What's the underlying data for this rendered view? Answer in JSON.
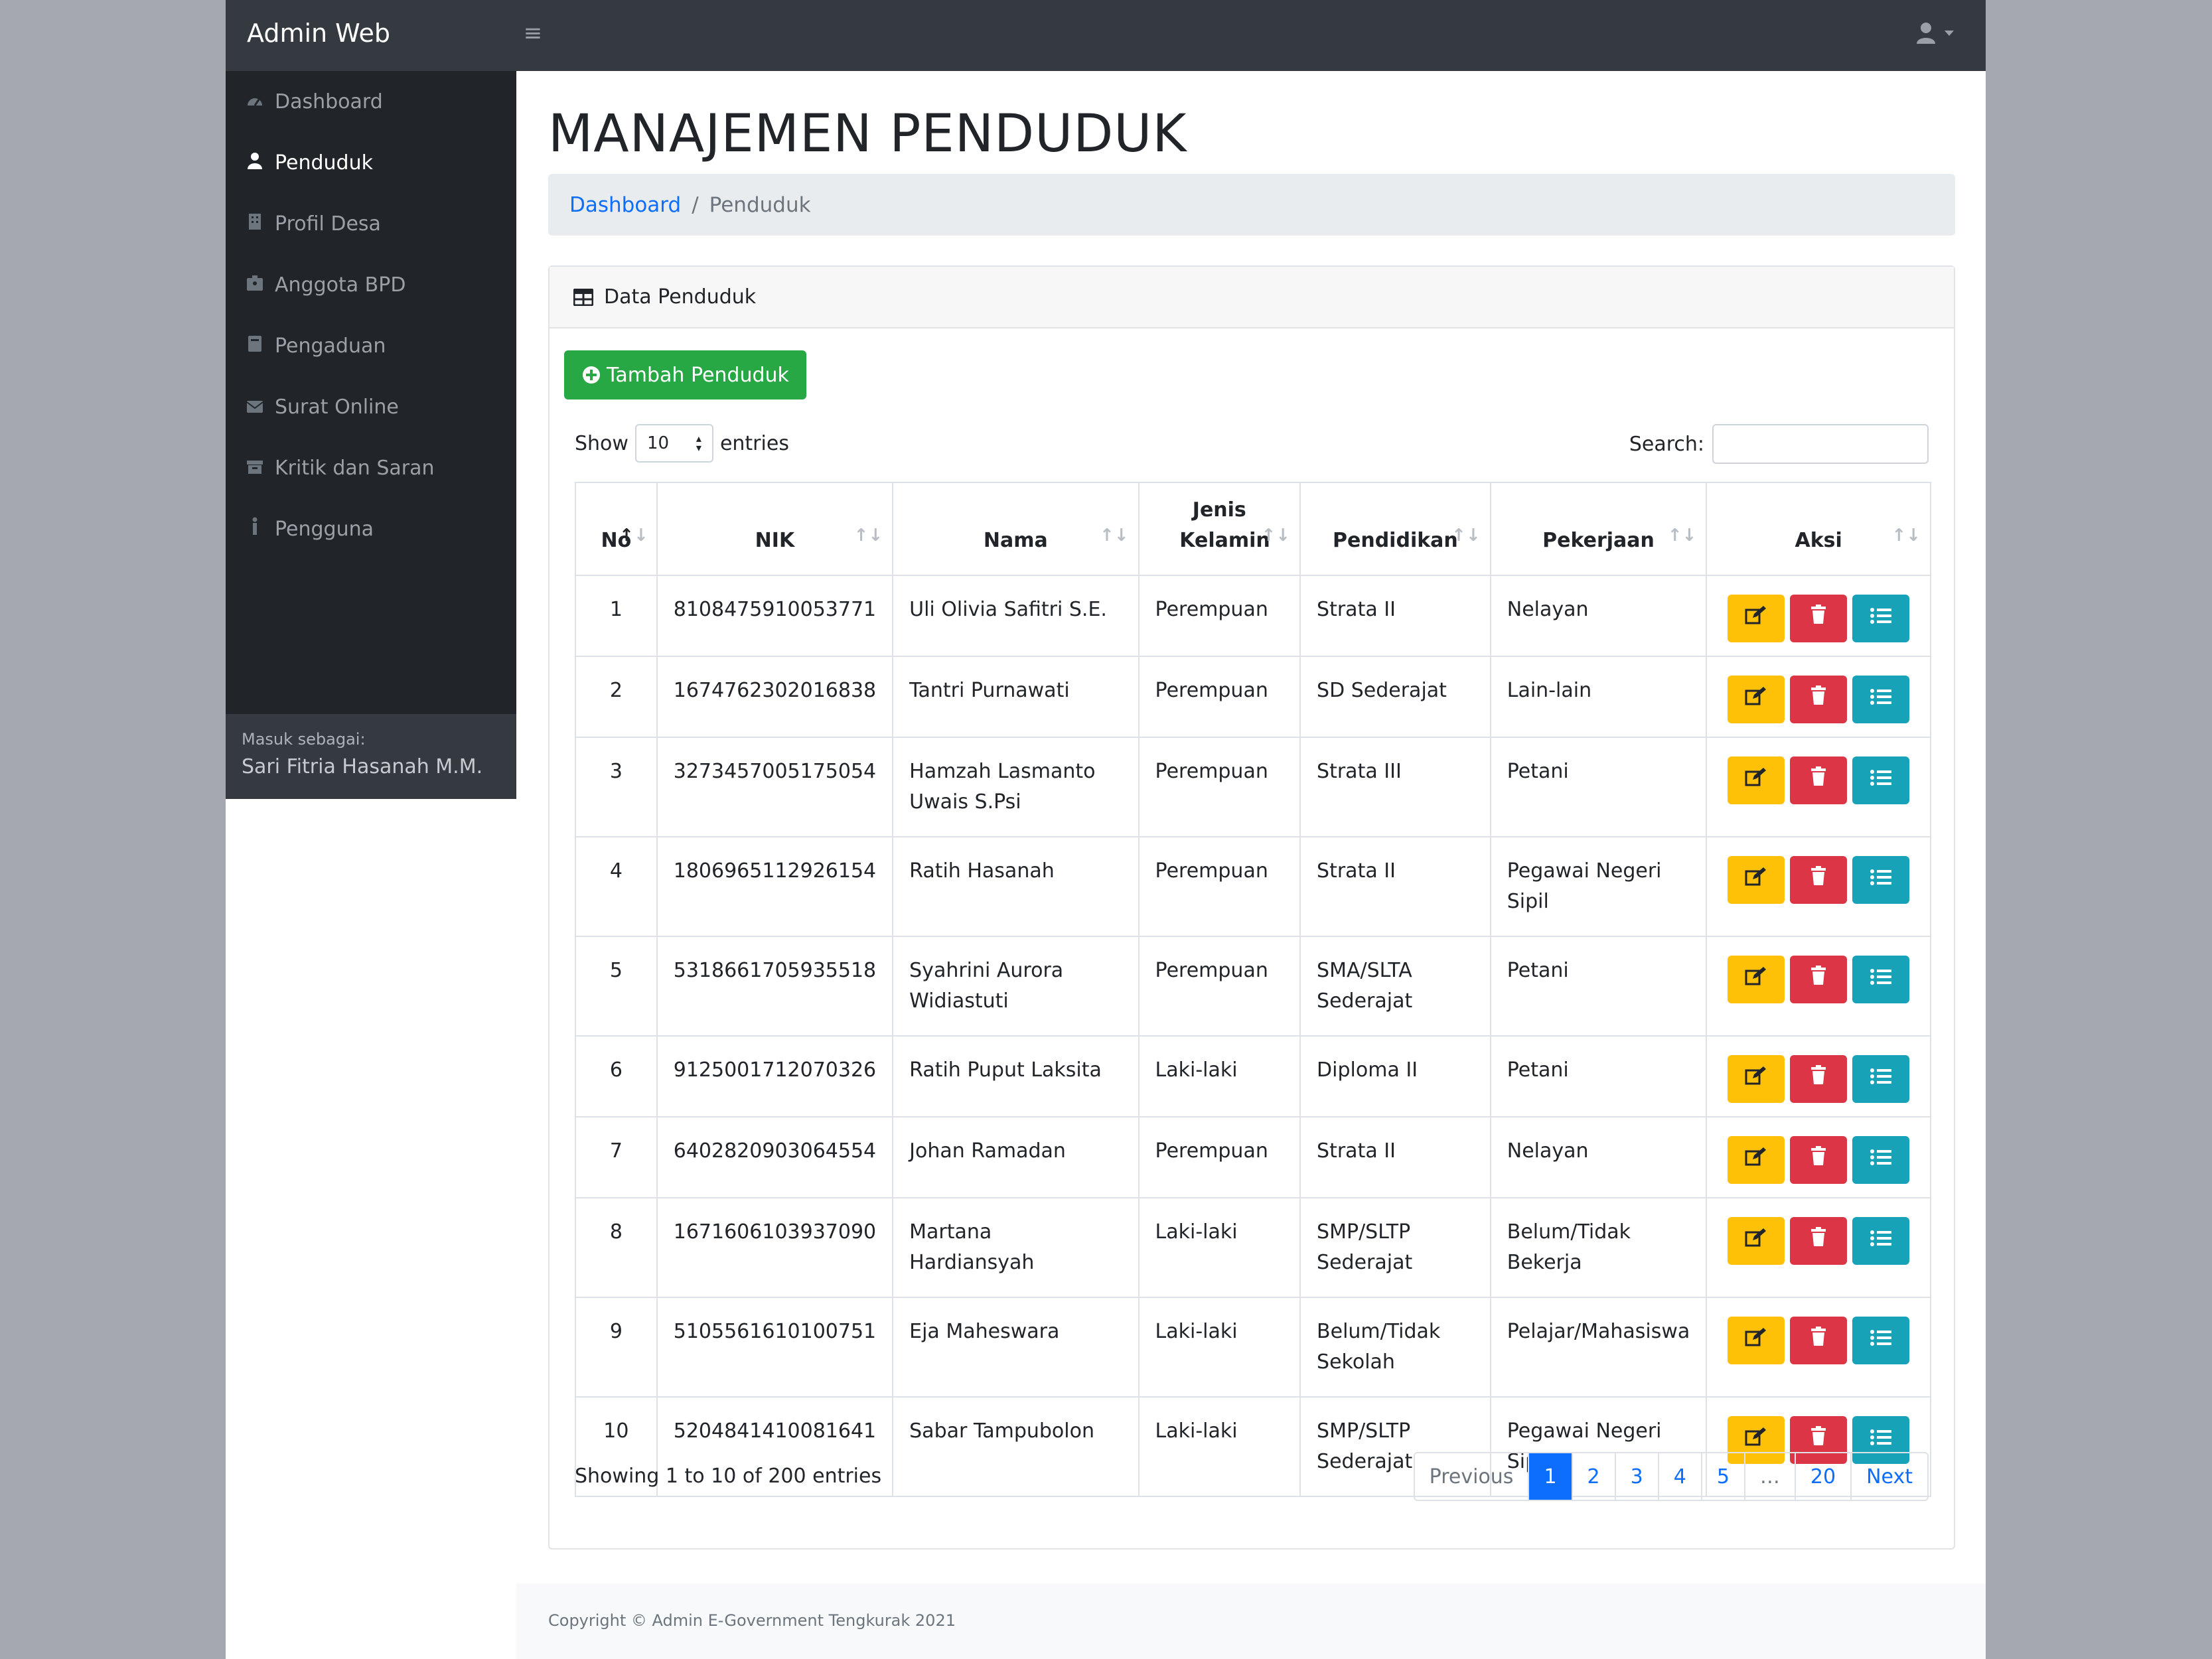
{
  "brand": "Admin Web",
  "sidebar": {
    "items": [
      {
        "label": "Dashboard",
        "icon": "tachometer-icon",
        "active": false
      },
      {
        "label": "Penduduk",
        "icon": "user-icon",
        "active": true
      },
      {
        "label": "Profil Desa",
        "icon": "building-icon",
        "active": false
      },
      {
        "label": "Anggota BPD",
        "icon": "id-badge-icon",
        "active": false
      },
      {
        "label": "Pengaduan",
        "icon": "book-icon",
        "active": false
      },
      {
        "label": "Surat Online",
        "icon": "envelope-icon",
        "active": false
      },
      {
        "label": "Kritik dan Saran",
        "icon": "archive-icon",
        "active": false
      },
      {
        "label": "Pengguna",
        "icon": "male-icon",
        "active": false
      }
    ],
    "footer": {
      "label": "Masuk sebagai:",
      "name": "Sari Fitria Hasanah M.M."
    }
  },
  "page": {
    "title": "MANAJEMEN PENDUDUK",
    "breadcrumb": {
      "link": "Dashboard",
      "current": "Penduduk"
    }
  },
  "card": {
    "header": "Data Penduduk",
    "add_button": "Tambah Penduduk",
    "show_label": "Show",
    "entries_label": "entries",
    "length_value": "10",
    "search_label": "Search:",
    "search_value": ""
  },
  "table": {
    "columns": [
      "No",
      "NIK",
      "Nama",
      "Jenis Kelamin",
      "Pendidikan",
      "Pekerjaan",
      "Aksi"
    ],
    "rows": [
      {
        "no": "1",
        "nik": "8108475910053771",
        "nama": "Uli Olivia Safitri S.E.",
        "jk": "Perempuan",
        "pendidikan": "Strata II",
        "pekerjaan": "Nelayan"
      },
      {
        "no": "2",
        "nik": "1674762302016838",
        "nama": "Tantri Purnawati",
        "jk": "Perempuan",
        "pendidikan": "SD Sederajat",
        "pekerjaan": "Lain-lain"
      },
      {
        "no": "3",
        "nik": "3273457005175054",
        "nama": "Hamzah Lasmanto Uwais S.Psi",
        "jk": "Perempuan",
        "pendidikan": "Strata III",
        "pekerjaan": "Petani"
      },
      {
        "no": "4",
        "nik": "1806965112926154",
        "nama": "Ratih Hasanah",
        "jk": "Perempuan",
        "pendidikan": "Strata II",
        "pekerjaan": "Pegawai Negeri Sipil"
      },
      {
        "no": "5",
        "nik": "5318661705935518",
        "nama": "Syahrini Aurora Widiastuti",
        "jk": "Perempuan",
        "pendidikan": "SMA/SLTA Sederajat",
        "pekerjaan": "Petani"
      },
      {
        "no": "6",
        "nik": "9125001712070326",
        "nama": "Ratih Puput Laksita",
        "jk": "Laki-laki",
        "pendidikan": "Diploma II",
        "pekerjaan": "Petani"
      },
      {
        "no": "7",
        "nik": "6402820903064554",
        "nama": "Johan Ramadan",
        "jk": "Perempuan",
        "pendidikan": "Strata II",
        "pekerjaan": "Nelayan"
      },
      {
        "no": "8",
        "nik": "1671606103937090",
        "nama": "Martana Hardiansyah",
        "jk": "Laki-laki",
        "pendidikan": "SMP/SLTP Sederajat",
        "pekerjaan": "Belum/Tidak Bekerja"
      },
      {
        "no": "9",
        "nik": "5105561610100751",
        "nama": "Eja Maheswara",
        "jk": "Laki-laki",
        "pendidikan": "Belum/Tidak Sekolah",
        "pekerjaan": "Pelajar/Mahasiswa"
      },
      {
        "no": "10",
        "nik": "5204841410081641",
        "nama": "Sabar Tampubolon",
        "jk": "Laki-laki",
        "pendidikan": "SMP/SLTP Sederajat",
        "pekerjaan": "Pegawai Negeri Sipil"
      }
    ]
  },
  "info": "Showing 1 to 10 of 200 entries",
  "pagination": {
    "previous": "Previous",
    "pages": [
      "1",
      "2",
      "3",
      "4",
      "5",
      "…",
      "20"
    ],
    "next": "Next",
    "active": "1"
  },
  "footer": "Copyright © Admin E-Government Tengkurak 2021",
  "colors": {
    "topbar": "#343a40",
    "sidebar": "#212529",
    "primary": "#0d6efd",
    "success": "#28a745",
    "warning": "#ffc107",
    "danger": "#dc3545",
    "info": "#17a2b8"
  }
}
